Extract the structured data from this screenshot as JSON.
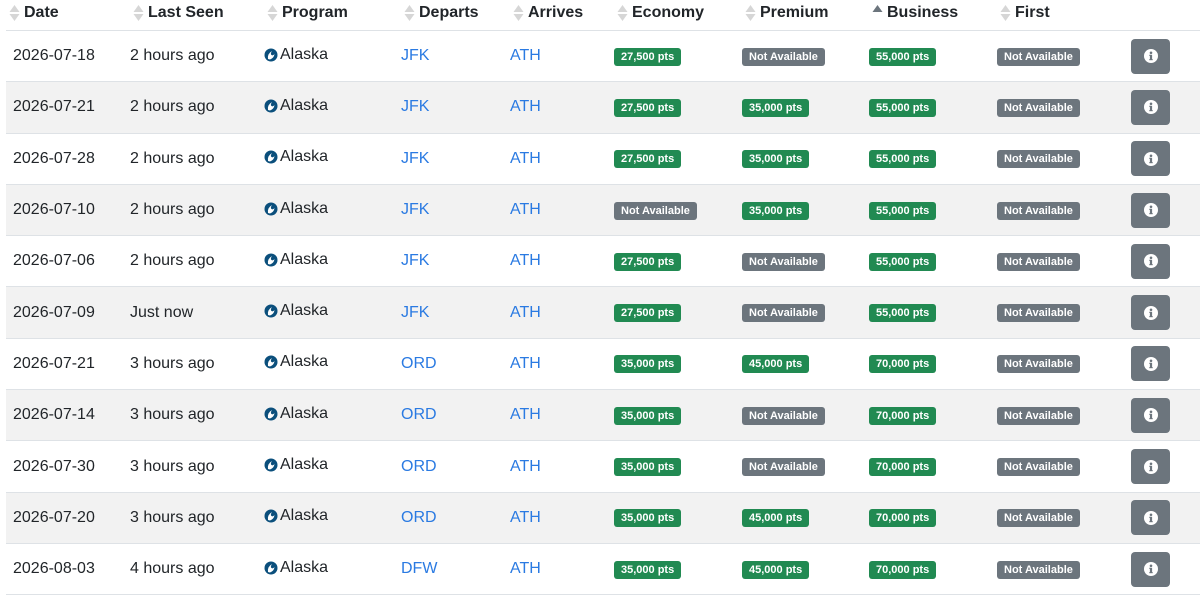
{
  "columns": [
    {
      "label": "Date",
      "sort": "none"
    },
    {
      "label": "Last Seen",
      "sort": "none"
    },
    {
      "label": "Program",
      "sort": "none"
    },
    {
      "label": "Departs",
      "sort": "none"
    },
    {
      "label": "Arrives",
      "sort": "none"
    },
    {
      "label": "Economy",
      "sort": "none"
    },
    {
      "label": "Premium",
      "sort": "none"
    },
    {
      "label": "Business",
      "sort": "ascending"
    },
    {
      "label": "First",
      "sort": "none"
    }
  ],
  "colors": {
    "available": "#218a52",
    "unavailable": "#6c757d",
    "link": "#2a7ae2",
    "stripe": "#f2f2f2"
  },
  "rows": [
    {
      "date": "2026-07-18",
      "last_seen": "2 hours ago",
      "program": "Alaska",
      "departs": "JFK",
      "arrives": "ATH",
      "economy": "27,500 pts",
      "premium": "Not Available",
      "business": "55,000 pts",
      "first": "Not Available"
    },
    {
      "date": "2026-07-21",
      "last_seen": "2 hours ago",
      "program": "Alaska",
      "departs": "JFK",
      "arrives": "ATH",
      "economy": "27,500 pts",
      "premium": "35,000 pts",
      "business": "55,000 pts",
      "first": "Not Available"
    },
    {
      "date": "2026-07-28",
      "last_seen": "2 hours ago",
      "program": "Alaska",
      "departs": "JFK",
      "arrives": "ATH",
      "economy": "27,500 pts",
      "premium": "35,000 pts",
      "business": "55,000 pts",
      "first": "Not Available"
    },
    {
      "date": "2026-07-10",
      "last_seen": "2 hours ago",
      "program": "Alaska",
      "departs": "JFK",
      "arrives": "ATH",
      "economy": "Not Available",
      "premium": "35,000 pts",
      "business": "55,000 pts",
      "first": "Not Available"
    },
    {
      "date": "2026-07-06",
      "last_seen": "2 hours ago",
      "program": "Alaska",
      "departs": "JFK",
      "arrives": "ATH",
      "economy": "27,500 pts",
      "premium": "Not Available",
      "business": "55,000 pts",
      "first": "Not Available"
    },
    {
      "date": "2026-07-09",
      "last_seen": "Just now",
      "program": "Alaska",
      "departs": "JFK",
      "arrives": "ATH",
      "economy": "27,500 pts",
      "premium": "Not Available",
      "business": "55,000 pts",
      "first": "Not Available"
    },
    {
      "date": "2026-07-21",
      "last_seen": "3 hours ago",
      "program": "Alaska",
      "departs": "ORD",
      "arrives": "ATH",
      "economy": "35,000 pts",
      "premium": "45,000 pts",
      "business": "70,000 pts",
      "first": "Not Available"
    },
    {
      "date": "2026-07-14",
      "last_seen": "3 hours ago",
      "program": "Alaska",
      "departs": "ORD",
      "arrives": "ATH",
      "economy": "35,000 pts",
      "premium": "Not Available",
      "business": "70,000 pts",
      "first": "Not Available"
    },
    {
      "date": "2026-07-30",
      "last_seen": "3 hours ago",
      "program": "Alaska",
      "departs": "ORD",
      "arrives": "ATH",
      "economy": "35,000 pts",
      "premium": "Not Available",
      "business": "70,000 pts",
      "first": "Not Available"
    },
    {
      "date": "2026-07-20",
      "last_seen": "3 hours ago",
      "program": "Alaska",
      "departs": "ORD",
      "arrives": "ATH",
      "economy": "35,000 pts",
      "premium": "45,000 pts",
      "business": "70,000 pts",
      "first": "Not Available"
    },
    {
      "date": "2026-08-03",
      "last_seen": "4 hours ago",
      "program": "Alaska",
      "departs": "DFW",
      "arrives": "ATH",
      "economy": "35,000 pts",
      "premium": "45,000 pts",
      "business": "70,000 pts",
      "first": "Not Available"
    }
  ]
}
